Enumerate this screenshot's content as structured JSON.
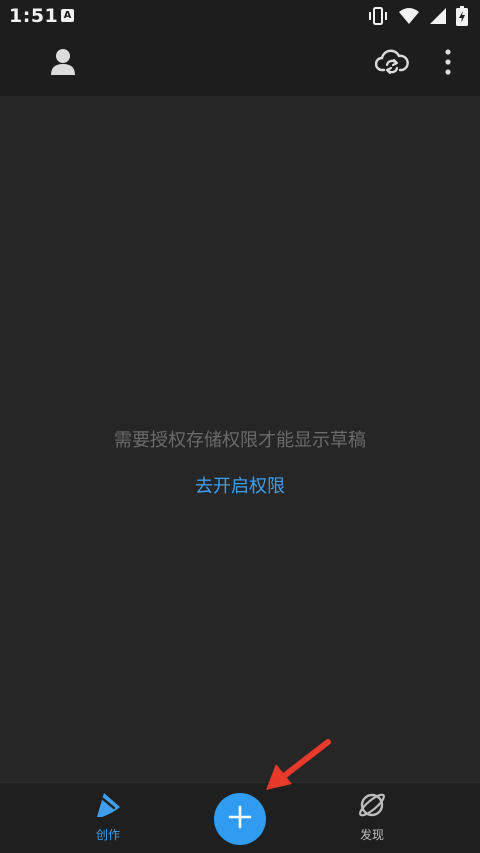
{
  "status_bar": {
    "time": "1:51",
    "notification_glyph": "A",
    "icons": [
      "vibrate-icon",
      "wifi-icon",
      "signal-icon",
      "battery-charging-icon"
    ]
  },
  "header": {
    "account_icon": "person-icon",
    "sync_icon": "cloud-sync-icon",
    "more_icon": "more-vertical-icon"
  },
  "main": {
    "empty_message": "需要授权存储权限才能显示草稿",
    "grant_permission_link": "去开启权限"
  },
  "bottom_nav": {
    "items": [
      {
        "label": "创作",
        "icon": "pen-create-icon",
        "active": true
      },
      {
        "label": "发现",
        "icon": "planet-icon",
        "active": false
      }
    ],
    "fab_icon": "plus-icon"
  },
  "colors": {
    "background": "#262626",
    "bar": "#1d1d1d",
    "accent": "#3f9fec",
    "fab": "#2f9cf2",
    "muted_text": "#6b6b6b",
    "annotation_arrow": "#e8392a"
  }
}
